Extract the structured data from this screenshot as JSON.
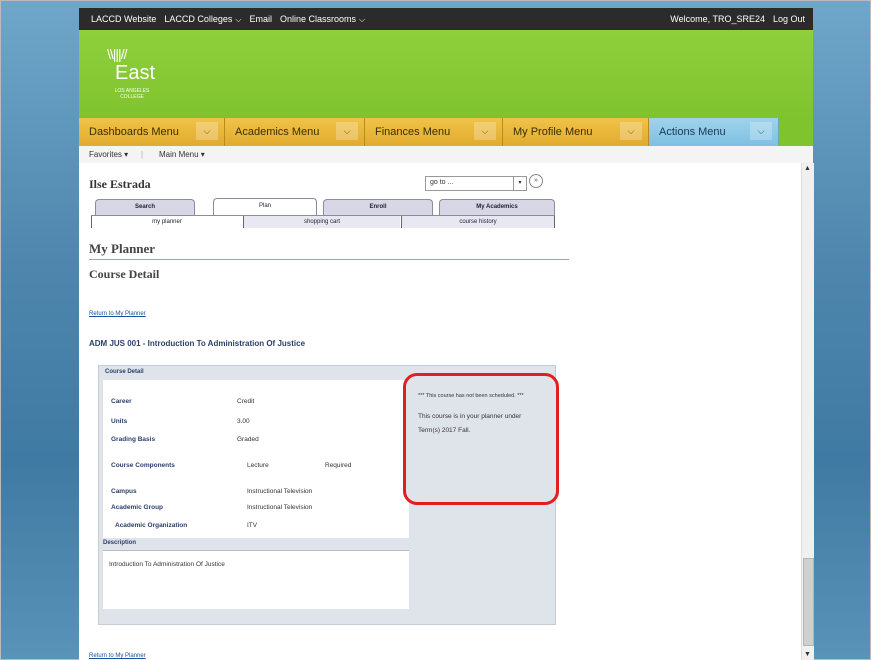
{
  "topbar": {
    "links": [
      "LACCD Website",
      "LACCD Colleges",
      "Email",
      "Online Classrooms"
    ],
    "welcome": "Welcome, TRO_SRE24",
    "logout": "Log Out"
  },
  "logo": {
    "rays": "\\\\|||//",
    "name": "East",
    "subline1": "LOS ANGELES",
    "subline2": "COLLEGE"
  },
  "menus": [
    {
      "label": "Dashboards Menu"
    },
    {
      "label": "Academics Menu"
    },
    {
      "label": "Finances Menu"
    },
    {
      "label": "My Profile Menu"
    },
    {
      "label": "Actions Menu"
    }
  ],
  "favbar": {
    "favorites": "Favorites ▾",
    "main_menu": "Main Menu ▾"
  },
  "student_name": "Ilse Estrada",
  "goto": {
    "value": "go to ...",
    "go_icon": "»"
  },
  "tabs": [
    "Search",
    "Plan",
    "Enroll",
    "My Academics"
  ],
  "subtabs": [
    "my planner",
    "shopping cart",
    "course history"
  ],
  "page_title": "My Planner",
  "section_title": "Course Detail",
  "return_link": "Return to My Planner",
  "course_title": "ADM JUS 001 - Introduction To Administration Of Justice",
  "course_detail": {
    "header": "Course Detail",
    "fields": [
      {
        "label": "Career",
        "value": "Credit"
      },
      {
        "label": "Units",
        "value": "3.00"
      },
      {
        "label": "Grading Basis",
        "value": "Graded"
      },
      {
        "label": "Course Components",
        "value": "Lecture",
        "extra": "Required"
      },
      {
        "label": "Campus",
        "value": "Instructional Television"
      },
      {
        "label": "Academic Group",
        "value": "Instructional Television"
      },
      {
        "label": "Academic Organization",
        "value": "ITV"
      }
    ],
    "description_header": "Description",
    "description": "Introduction To Administration Of Justice"
  },
  "notice": {
    "line1": "*** This course has not been scheduled. ***",
    "line2": "This course is in your planner under Term(s) 2017 Fall."
  },
  "colors": {
    "highlight_border": "#e02020",
    "banner": "#7fc32e",
    "menu": "#e0ab2e"
  }
}
